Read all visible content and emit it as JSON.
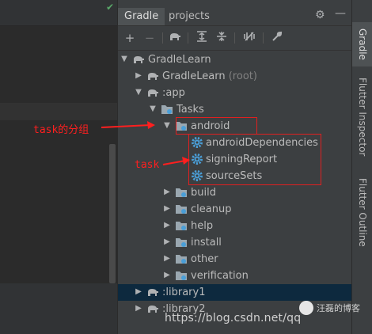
{
  "panel": {
    "tabs": [
      "Gradle",
      "projects"
    ],
    "active_tab": "Gradle"
  },
  "toolbar": {
    "icons": [
      "plus-icon",
      "minus-icon",
      "elephant-icon",
      "expand-all-icon",
      "collapse-all-icon",
      "toggle-offline-icon",
      "wrench-icon"
    ]
  },
  "tree": [
    {
      "label": "GradleLearn",
      "suffix": "",
      "icon": "elephant-icon",
      "arrow": "down"
    },
    {
      "label": "GradleLearn",
      "suffix": "(root)",
      "icon": "elephant-icon",
      "arrow": "right"
    },
    {
      "label": ":app",
      "suffix": "",
      "icon": "elephant-icon",
      "arrow": "down"
    },
    {
      "label": "Tasks",
      "suffix": "",
      "icon": "folder-icon",
      "arrow": "down"
    },
    {
      "label": "android",
      "suffix": "",
      "icon": "folder-icon",
      "arrow": "down"
    },
    {
      "label": "androidDependencies",
      "suffix": "",
      "icon": "gear-icon",
      "arrow": "none"
    },
    {
      "label": "signingReport",
      "suffix": "",
      "icon": "gear-icon",
      "arrow": "none"
    },
    {
      "label": "sourceSets",
      "suffix": "",
      "icon": "gear-icon",
      "arrow": "none"
    },
    {
      "label": "build",
      "suffix": "",
      "icon": "folder-icon",
      "arrow": "right"
    },
    {
      "label": "cleanup",
      "suffix": "",
      "icon": "folder-icon",
      "arrow": "right"
    },
    {
      "label": "help",
      "suffix": "",
      "icon": "folder-icon",
      "arrow": "right"
    },
    {
      "label": "install",
      "suffix": "",
      "icon": "folder-icon",
      "arrow": "right"
    },
    {
      "label": "other",
      "suffix": "",
      "icon": "folder-icon",
      "arrow": "right"
    },
    {
      "label": "verification",
      "suffix": "",
      "icon": "folder-icon",
      "arrow": "right"
    },
    {
      "label": ":library1",
      "suffix": "",
      "icon": "elephant-icon",
      "arrow": "right"
    },
    {
      "label": ":library2",
      "suffix": "",
      "icon": "elephant-icon",
      "arrow": "right"
    }
  ],
  "stripe": {
    "tabs": [
      "Gradle",
      "Flutter Inspector",
      "Flutter Outline"
    ]
  },
  "annotations": {
    "group_label": "task的分组",
    "task_label": "task"
  },
  "watermark": {
    "url": "https://blog.csdn.net/qq",
    "name": "汪磊的博客"
  },
  "colors": {
    "annotation": "#ff1f1f",
    "selection": "#0d293e",
    "gear": "#4a9fd8"
  }
}
